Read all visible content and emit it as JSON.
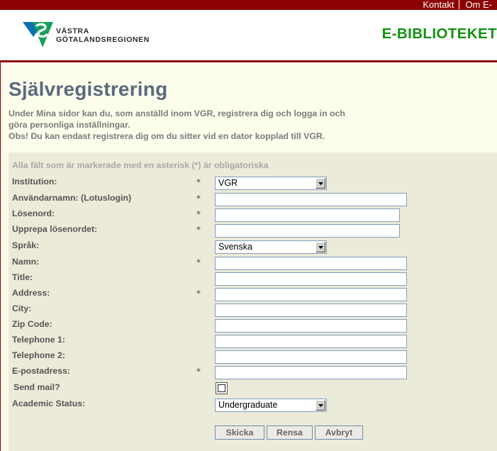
{
  "topnav": {
    "contact": "Kontakt",
    "about": "Om E-"
  },
  "header": {
    "logo_line1": "VÄSTRA",
    "logo_line2": "GÖTALANDSREGIONEN",
    "site_title": "E-BIBLIOTEKET"
  },
  "page": {
    "title": "Självregistrering",
    "intro_line1": "Under Mina sidor kan du, som anställd inom VGR, registrera dig och logga in och",
    "intro_line2": "göra personliga inställningar.",
    "intro_line3": "Obs! Du kan endast registrera dig om du sitter vid en dator kopplad till VGR."
  },
  "form": {
    "required_note": "Alla fält som är markerade med en asterisk (*) är obligatoriska",
    "asterisk": "*",
    "fields": {
      "institution": {
        "label": "Institution:",
        "value": "VGR"
      },
      "username": {
        "label": "Användarnamn: (Lotuslogin)",
        "value": ""
      },
      "password": {
        "label": "Lösenord:",
        "value": ""
      },
      "password_repeat": {
        "label": "Upprepa lösenordet:",
        "value": ""
      },
      "language": {
        "label": "Språk:",
        "value": "Svenska"
      },
      "name": {
        "label": "Namn:",
        "value": ""
      },
      "title": {
        "label": "Title:",
        "value": ""
      },
      "address": {
        "label": "Address:",
        "value": ""
      },
      "city": {
        "label": "City:",
        "value": ""
      },
      "zip": {
        "label": "Zip Code:",
        "value": ""
      },
      "phone1": {
        "label": "Telephone 1:",
        "value": ""
      },
      "phone2": {
        "label": "Telephone 2:",
        "value": ""
      },
      "email": {
        "label": "E-postadress:",
        "value": ""
      },
      "send_mail": {
        "label": "Send mail?",
        "checked": false
      },
      "academic_status": {
        "label": "Academic Status:",
        "value": "Undergraduate"
      }
    },
    "buttons": {
      "submit": "Skicka",
      "reset": "Rensa",
      "cancel": "Avbryt"
    }
  }
}
